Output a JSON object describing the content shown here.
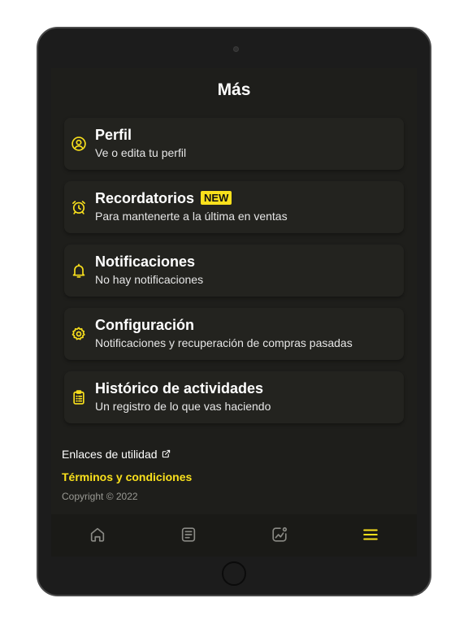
{
  "page": {
    "title": "Más"
  },
  "menu": [
    {
      "title": "Perfil",
      "subtitle": "Ve o edita tu perfil",
      "icon": "user-circle-icon"
    },
    {
      "title": "Recordatorios",
      "subtitle": "Para mantenerte a la última en ventas",
      "icon": "alarm-clock-icon",
      "badge": "NEW"
    },
    {
      "title": "Notificaciones",
      "subtitle": "No hay notificaciones",
      "icon": "bell-icon"
    },
    {
      "title": "Configuración",
      "subtitle": "Notificaciones y recuperación de compras pasadas",
      "icon": "gear-icon"
    },
    {
      "title": "Histórico de actividades",
      "subtitle": "Un registro de lo que vas haciendo",
      "icon": "clipboard-icon"
    }
  ],
  "footer": {
    "useful_links": "Enlaces de utilidad",
    "terms": "Términos y condiciones",
    "copyright": "Copyright © 2022"
  },
  "tabs": [
    {
      "icon": "home-icon",
      "active": false
    },
    {
      "icon": "list-icon",
      "active": false
    },
    {
      "icon": "chart-icon",
      "active": false
    },
    {
      "icon": "menu-icon",
      "active": true
    }
  ],
  "colors": {
    "accent": "#f9e01c",
    "background": "#1e1e1b",
    "card": "#23231f",
    "text": "#ffffff",
    "inactive_icon": "#8a8a85"
  }
}
